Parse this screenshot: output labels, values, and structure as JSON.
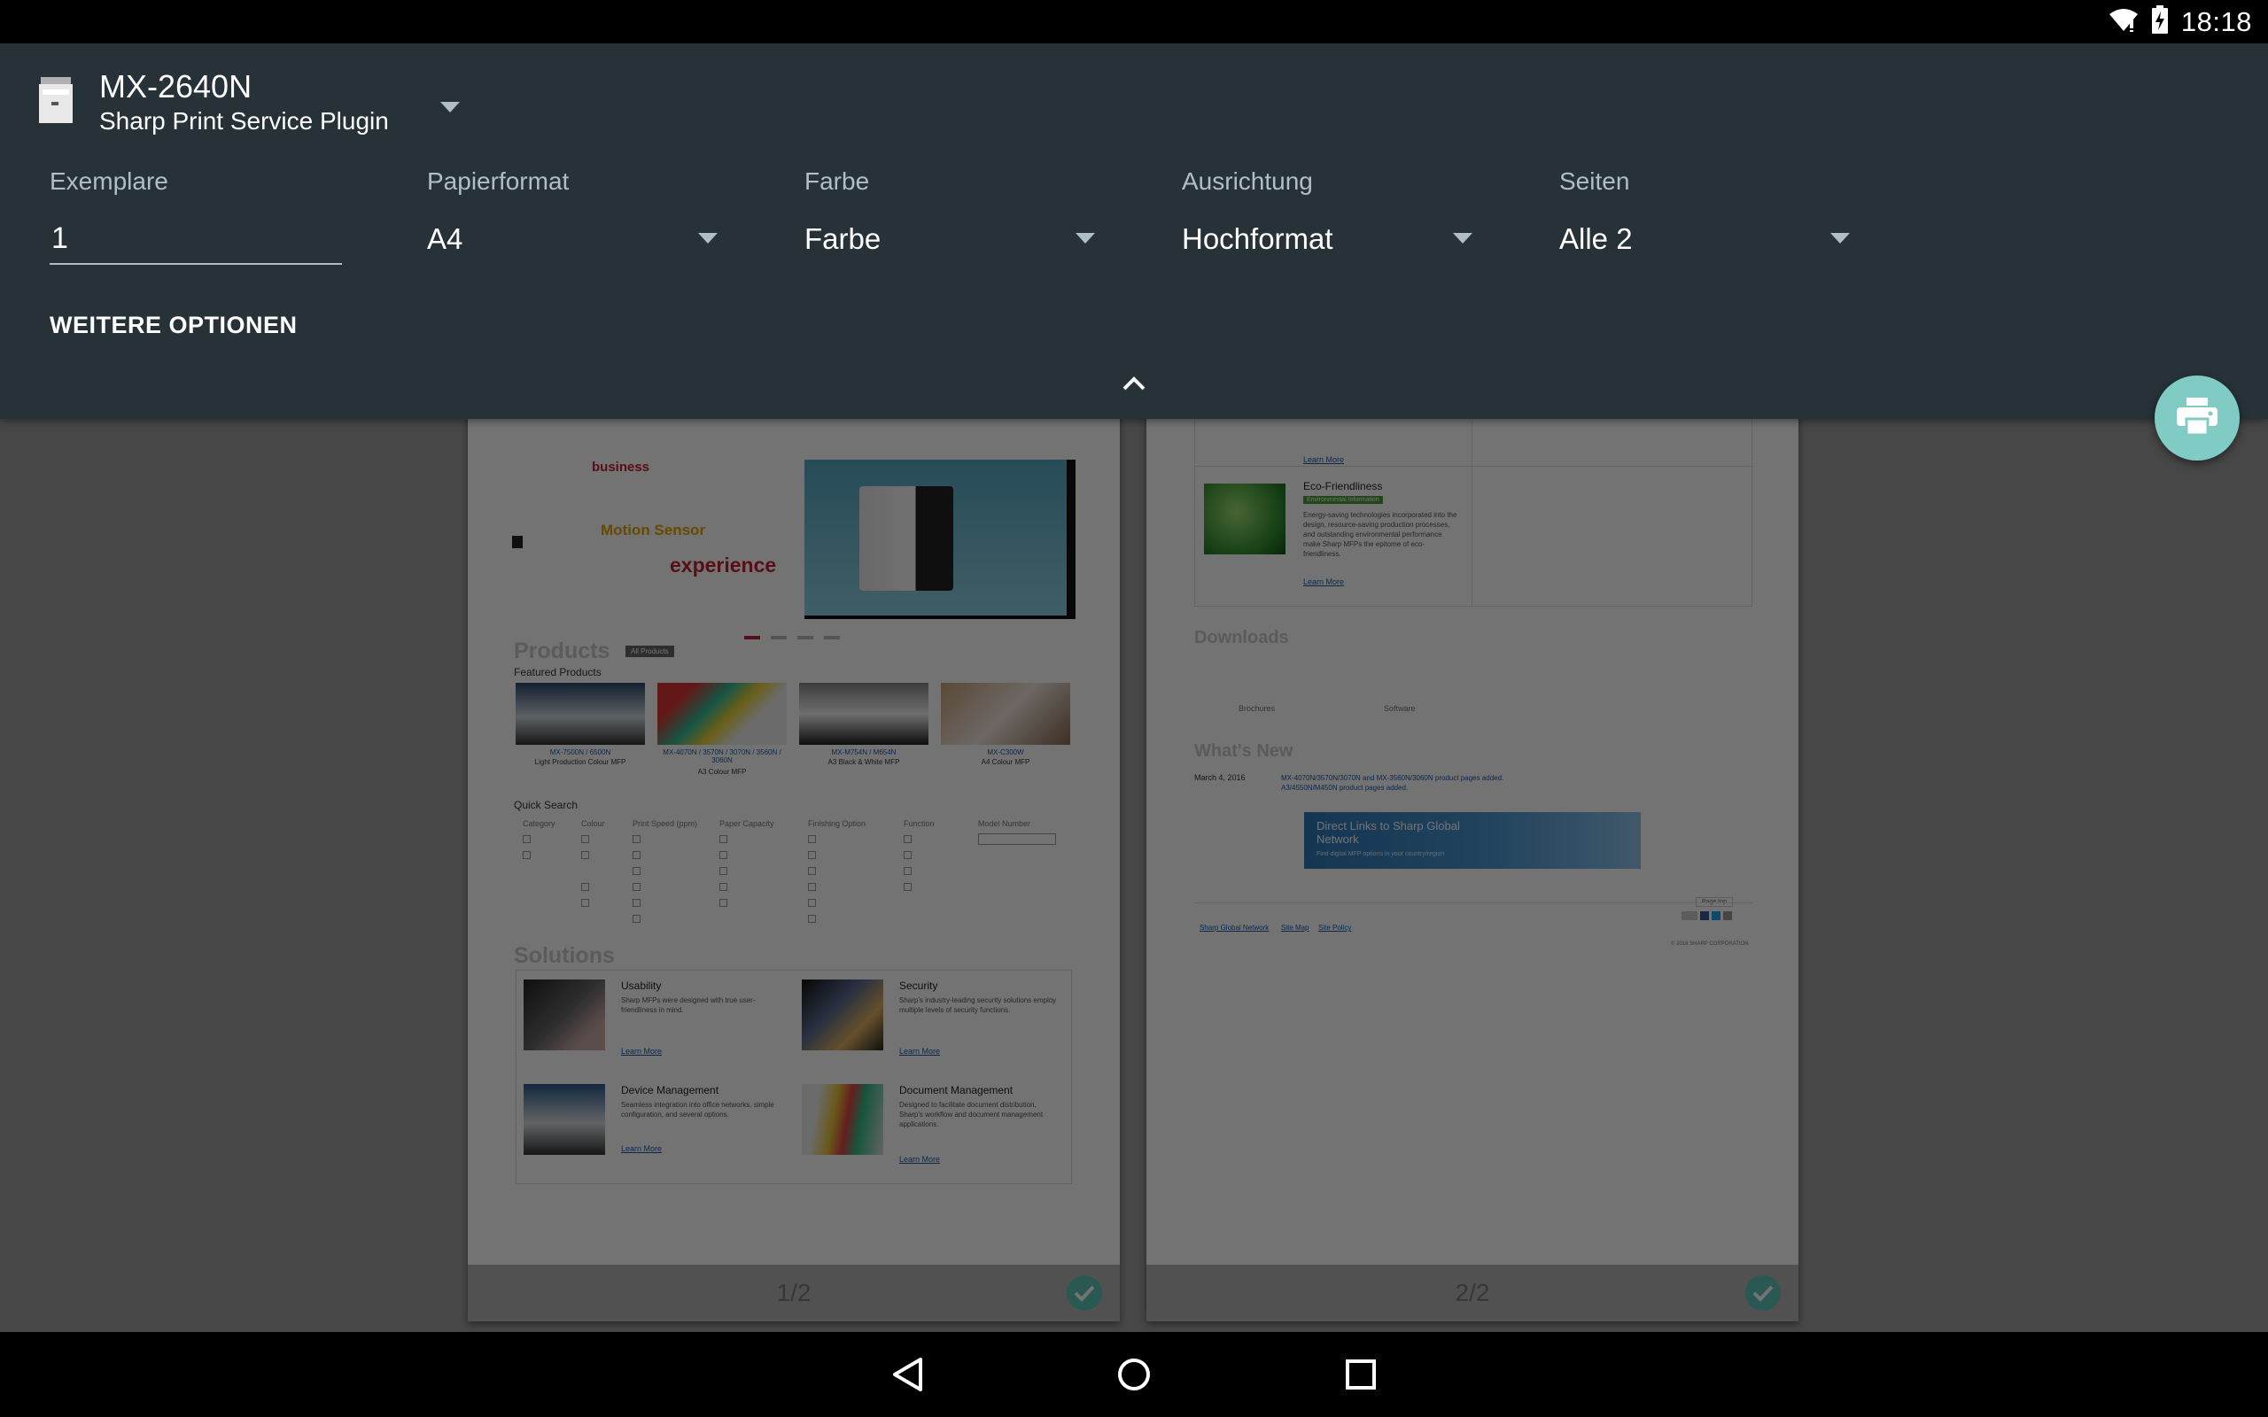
{
  "status_bar": {
    "time": "18:18",
    "wifi_icon": "wifi-icon",
    "battery_icon": "battery-charging-icon"
  },
  "printer": {
    "name": "MX-2640N",
    "service": "Sharp Print Service Plugin"
  },
  "options": {
    "copies": {
      "label": "Exemplare",
      "value": "1"
    },
    "paper_size": {
      "label": "Papierformat",
      "value": "A4"
    },
    "color": {
      "label": "Farbe",
      "value": "Farbe"
    },
    "orientation": {
      "label": "Ausrichtung",
      "value": "Hochformat"
    },
    "pages": {
      "label": "Seiten",
      "value": "Alle 2"
    },
    "more_options": "WEITERE OPTIONEN"
  },
  "preview": {
    "pages": [
      {
        "label": "1/2",
        "checked": true
      },
      {
        "label": "2/2",
        "checked": true
      }
    ],
    "page1": {
      "banner_word1": "business",
      "banner_word2": "Motion Sensor",
      "banner_word3": "experience",
      "products_heading": "Products",
      "all_products": "All Products",
      "featured": "Featured Products",
      "products": [
        {
          "model": "MX-7500N / 6500N",
          "desc": "Light Production Colour MFP"
        },
        {
          "model": "MX-4070N / 3570N / 3070N / 3560N / 3060N",
          "desc": "A3 Colour MFP"
        },
        {
          "model": "MX-M754N / M654N",
          "desc": "A3 Black & White MFP"
        },
        {
          "model": "MX-C300W",
          "desc": "A4 Colour MFP"
        }
      ],
      "quick_search": "Quick Search",
      "qs_columns": [
        "Category",
        "Colour",
        "Print Speed (ppm)",
        "Paper Capacity",
        "Finishing Option",
        "Function",
        "Model Number"
      ],
      "solutions_heading": "Solutions",
      "solutions": [
        {
          "title": "Usability",
          "text": "Sharp MFPs were designed with true user-friendliness in mind.",
          "link": "Learn More"
        },
        {
          "title": "Security",
          "text": "Sharp's industry-leading security solutions employ multiple levels of security functions.",
          "link": "Learn More"
        },
        {
          "title": "Device Management",
          "text": "Seamless integration into office networks, simple configuration, and several options.",
          "link": "Learn More"
        },
        {
          "title": "Document Management",
          "text": "Designed to facilitate document distribution, Sharp's workflow and document management applications.",
          "link": "Learn More"
        }
      ]
    },
    "page2": {
      "learn_more_top": "Learn More",
      "eco_title": "Eco-Friendliness",
      "eco_badge": "Environmental Information",
      "eco_text": "Energy-saving technologies incorporated into the design, resource-saving production processes, and outstanding environmental performance make Sharp MFPs the epitome of eco-friendliness.",
      "eco_link": "Learn More",
      "downloads": "Downloads",
      "dl_items": [
        "Brochures",
        "Software"
      ],
      "whats_new": "What's New",
      "news_date": "March 4, 2016",
      "news_text": "MX-4070N/3570N/3070N and MX-3560N/3060N product pages added. A3/4550N/M450N product pages added.",
      "direct_links_title": "Direct Links to Sharp Global Network",
      "direct_links_sub": "Find digital MFP options in your country/region",
      "page_top": "Page top",
      "footer_links": [
        "Sharp Global Network",
        "Site Map",
        "Site Policy"
      ],
      "copyright": "© 2016 SHARP CORPORATION"
    }
  }
}
